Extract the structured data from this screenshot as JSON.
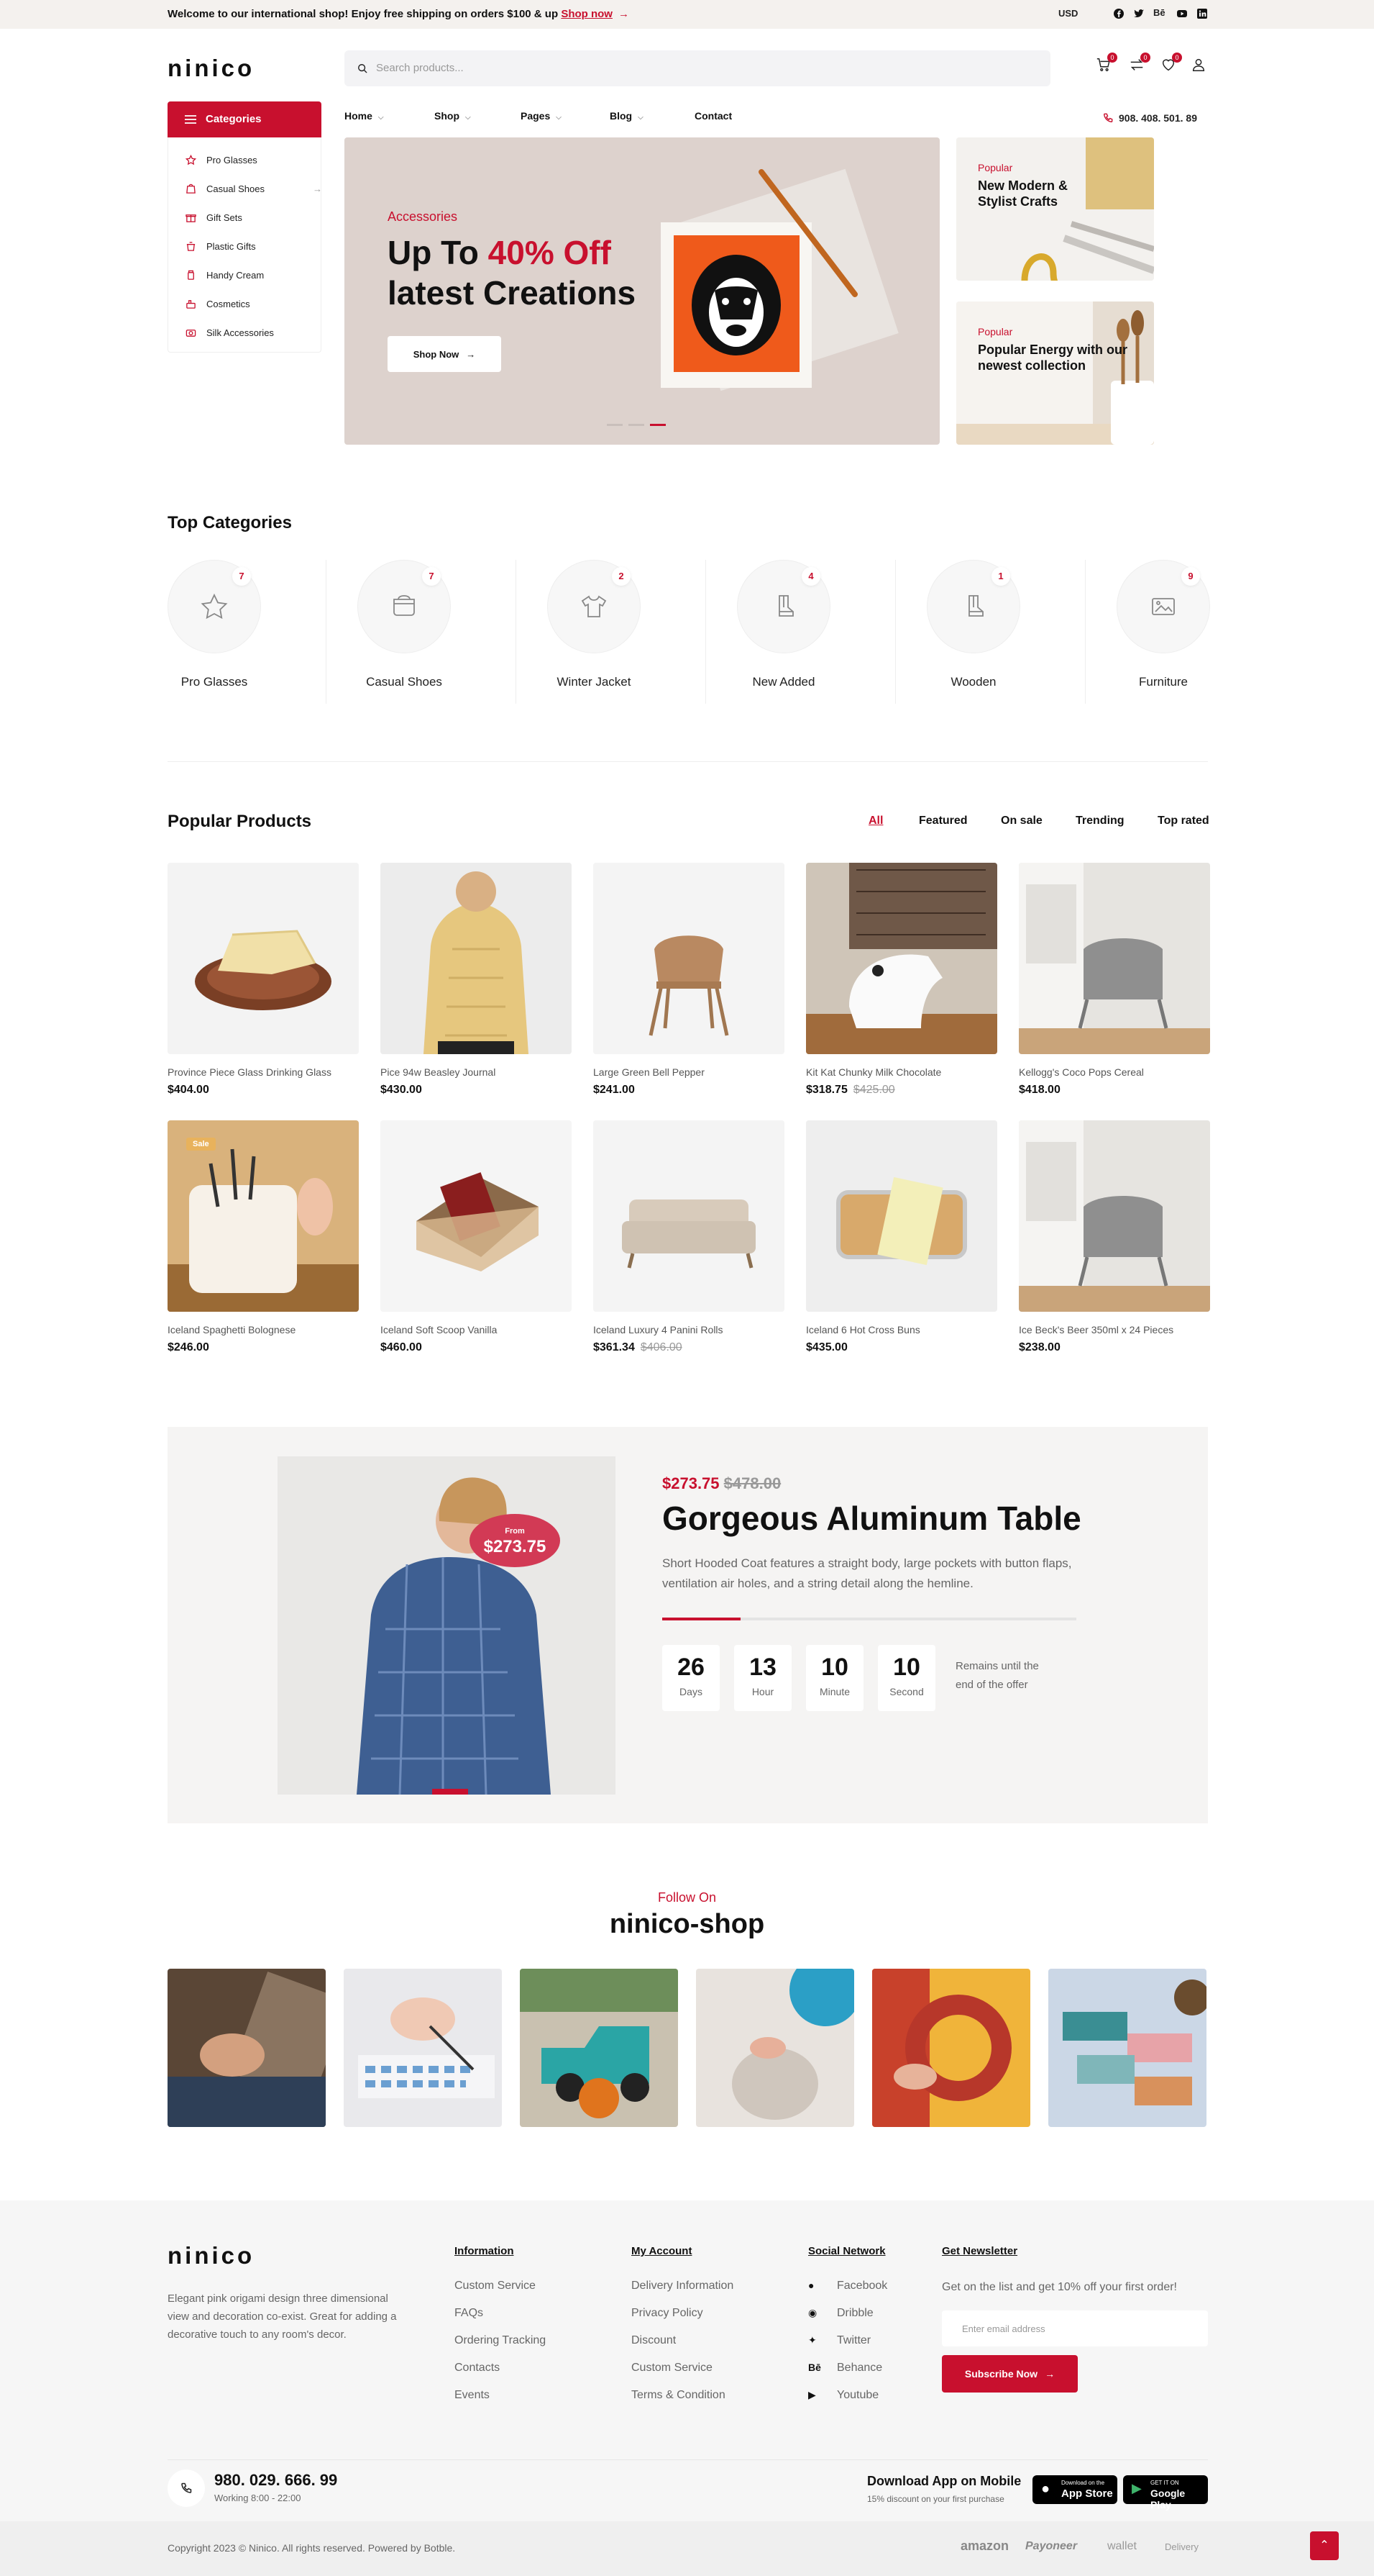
{
  "topbar": {
    "message": "Welcome to our international shop! Enjoy free shipping on orders $100 & up",
    "link": "Shop now",
    "currency": "USD"
  },
  "header": {
    "logo": "ninico",
    "search_placeholder": "Search products...",
    "cart_count": "0",
    "compare_count": "0",
    "wishlist_count": "0"
  },
  "nav": {
    "categories_label": "Categories",
    "items": [
      "Home",
      "Shop",
      "Pages",
      "Blog",
      "Contact"
    ],
    "phone": "908. 408. 501. 89"
  },
  "categories_menu": [
    "Pro Glasses",
    "Casual Shoes",
    "Gift Sets",
    "Plastic Gifts",
    "Handy Cream",
    "Cosmetics",
    "Silk Accessories"
  ],
  "hero": {
    "kicker": "Accessories",
    "title_1": "Up To",
    "title_hl": "40% Off",
    "title_2": "latest Creations",
    "button": "Shop Now"
  },
  "side_banners": [
    {
      "kicker": "Popular",
      "title": "New Modern & Stylist Crafts"
    },
    {
      "kicker": "Popular",
      "title": "Popular Energy with our newest collection"
    }
  ],
  "top_categories": {
    "title": "Top Categories",
    "items": [
      {
        "name": "Pro Glasses",
        "count": "7"
      },
      {
        "name": "Casual Shoes",
        "count": "7"
      },
      {
        "name": "Winter Jacket",
        "count": "2"
      },
      {
        "name": "New Added",
        "count": "4"
      },
      {
        "name": "Wooden",
        "count": "1"
      },
      {
        "name": "Furniture",
        "count": "9"
      }
    ]
  },
  "popular": {
    "title": "Popular Products",
    "tabs": [
      "All",
      "Featured",
      "On sale",
      "Trending",
      "Top rated"
    ],
    "products": [
      {
        "name": "Province Piece Glass Drinking Glass",
        "price": "$404.00",
        "old": ""
      },
      {
        "name": "Pice 94w Beasley Journal",
        "price": "$430.00",
        "old": ""
      },
      {
        "name": "Large Green Bell Pepper",
        "price": "$241.00",
        "old": ""
      },
      {
        "name": "Kit Kat Chunky Milk Chocolate",
        "price": "$318.75",
        "old": "$425.00"
      },
      {
        "name": "Kellogg's Coco Pops Cereal",
        "price": "$418.00",
        "old": ""
      },
      {
        "name": "Iceland Spaghetti Bolognese",
        "price": "$246.00",
        "old": "",
        "badge": "Sale"
      },
      {
        "name": "Iceland Soft Scoop Vanilla",
        "price": "$460.00",
        "old": ""
      },
      {
        "name": "Iceland Luxury 4 Panini Rolls",
        "price": "$361.34",
        "old": "$406.00"
      },
      {
        "name": "Iceland 6 Hot Cross Buns",
        "price": "$435.00",
        "old": ""
      },
      {
        "name": "Ice Beck's Beer 350ml x 24 Pieces",
        "price": "$238.00",
        "old": ""
      }
    ]
  },
  "deal": {
    "price": "$273.75",
    "old": "$478.00",
    "title": "Gorgeous Aluminum Table",
    "desc": "Short Hooded Coat features a straight body, large pockets with button flaps, ventilation air holes, and a string detail along the hemline.",
    "from": "From",
    "bubble_price": "$273.75",
    "progress": 0.19,
    "countdown": [
      {
        "n": "26",
        "u": "Days"
      },
      {
        "n": "13",
        "u": "Hour"
      },
      {
        "n": "10",
        "u": "Minute"
      },
      {
        "n": "10",
        "u": "Second"
      }
    ],
    "remains": "Remains until the end of the offer"
  },
  "insta": {
    "kicker": "Follow On",
    "title": "ninico-shop"
  },
  "footer": {
    "desc": "Elegant pink origami design three dimensional view and decoration co-exist. Great for adding a decorative touch to any room's decor.",
    "info_title": "Information",
    "info": [
      "Custom Service",
      "FAQs",
      "Ordering Tracking",
      "Contacts",
      "Events"
    ],
    "account_title": "My Account",
    "account": [
      "Delivery Information",
      "Privacy Policy",
      "Discount",
      "Custom Service",
      "Terms & Condition"
    ],
    "social_title": "Social Network",
    "social": [
      "Facebook",
      "Dribble",
      "Twitter",
      "Behance",
      "Youtube"
    ],
    "news_title": "Get Newsletter",
    "news_text": "Get on the list and get 10% off your first order!",
    "email_placeholder": "Enter email address",
    "subscribe": "Subscribe Now",
    "phone": "980. 029. 666. 99",
    "hours": "Working 8:00 - 22:00",
    "app_title": "Download App on Mobile",
    "app_sub": "15% discount on your first purchase",
    "appstore_small": "Download on the",
    "appstore": "App Store",
    "gplay_small": "GET IT ON",
    "gplay": "Google Play",
    "copyright": "Copyright 2023 © Ninico. All rights reserved. Powered by Botble.",
    "partners": [
      "amazon",
      "Payoneer",
      "wallet",
      "Delivery"
    ]
  },
  "colors": {
    "accent": "#c8102e",
    "hero_bg": "#ddd2cd",
    "topbar_bg": "#f4f1ee"
  }
}
